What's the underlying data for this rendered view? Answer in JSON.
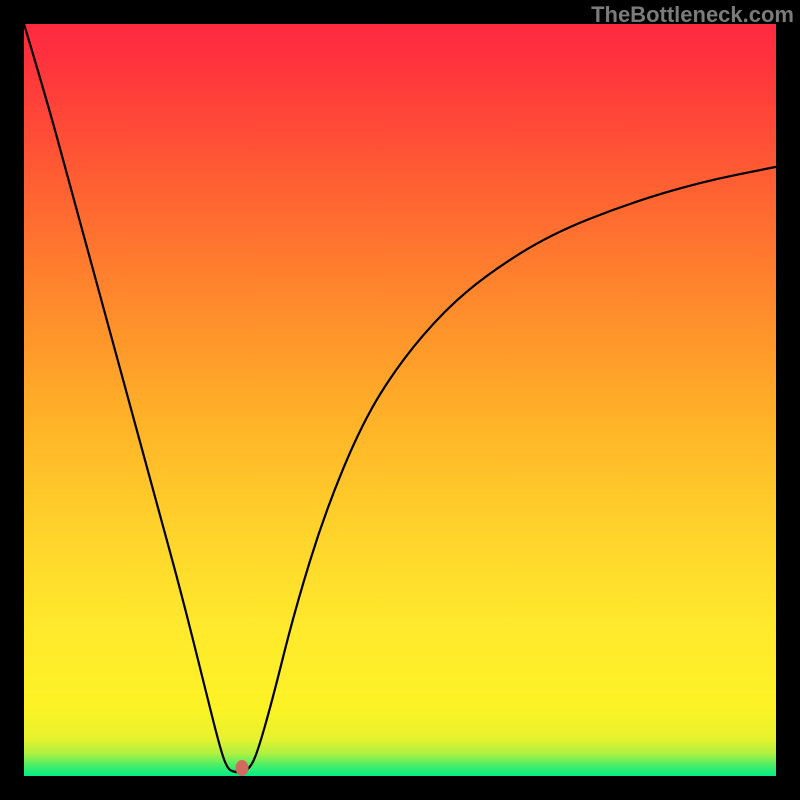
{
  "watermark": "TheBottleneck.com",
  "chart_data": {
    "type": "line",
    "title": "",
    "xlabel": "",
    "ylabel": "",
    "xlim": [
      0,
      100
    ],
    "ylim": [
      0,
      100
    ],
    "series": [
      {
        "name": "bottleneck-curve",
        "x": [
          0,
          3,
          6,
          9,
          12,
          15,
          18,
          21,
          24,
          26,
          27,
          28,
          29,
          30,
          31,
          33,
          36,
          40,
          45,
          50,
          56,
          62,
          70,
          80,
          90,
          100
        ],
        "y": [
          100,
          90,
          79,
          68,
          57,
          46,
          35,
          24,
          12,
          4,
          1,
          0.5,
          0.5,
          1,
          3,
          10,
          22,
          35,
          47,
          55,
          62,
          67,
          72,
          76,
          79,
          81
        ]
      }
    ],
    "marker": {
      "x": 29,
      "y": 1
    },
    "background": {
      "type": "vertical-gradient",
      "stops": [
        {
          "pos": 0,
          "color": "#02ec87"
        },
        {
          "pos": 9,
          "color": "#fbf324"
        },
        {
          "pos": 47,
          "color": "#ffb328"
        },
        {
          "pos": 100,
          "color": "#ff2a40"
        }
      ]
    }
  }
}
